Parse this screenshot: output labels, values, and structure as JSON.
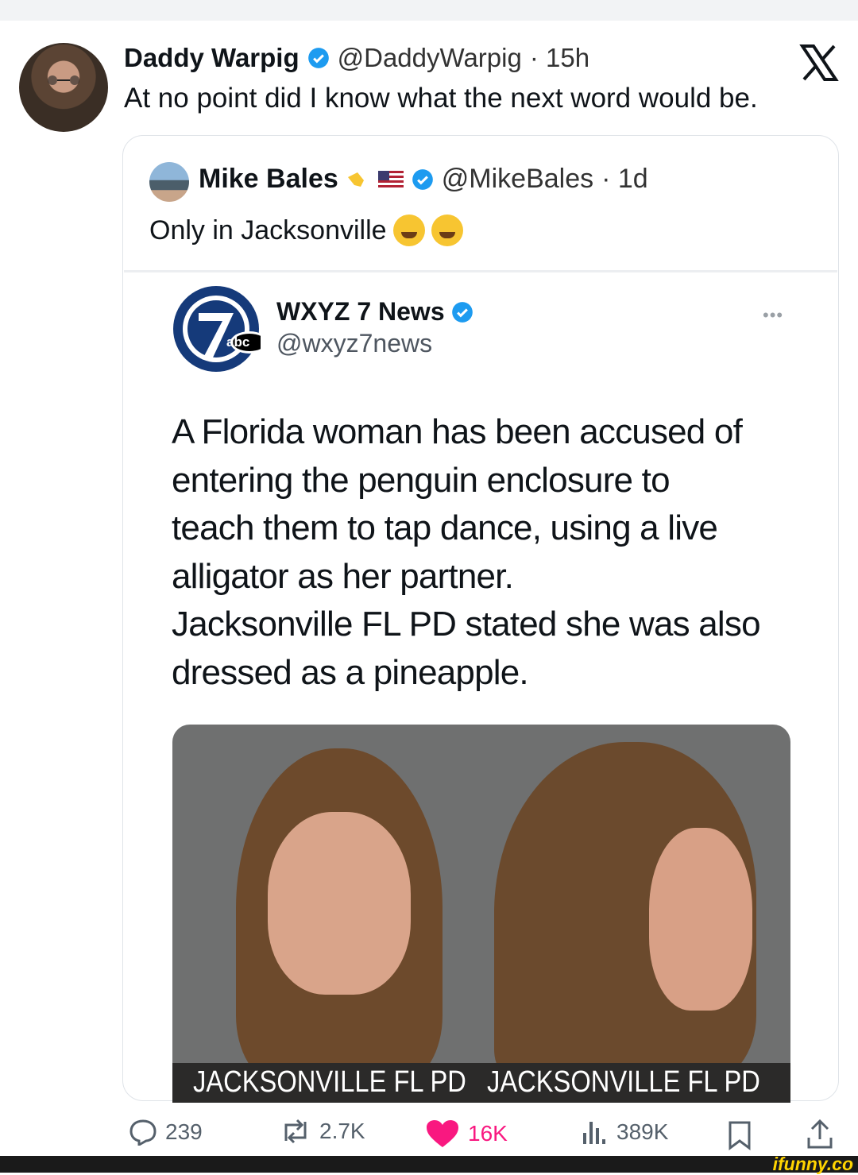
{
  "tweet": {
    "author_name": "Daddy Warpig",
    "author_handle": "@DaddyWarpig",
    "time": "· 15h",
    "text": "At no point did I know what the next word would be."
  },
  "quote": {
    "author_name": "Mike Bales",
    "author_handle": "@MikeBales",
    "time": "· 1d",
    "text": "Only in Jacksonville"
  },
  "embedded": {
    "name": "WXYZ 7 News",
    "handle": "@wxyz7news",
    "logo_text": "abc",
    "more": "•••",
    "lines": [
      "A Florida woman has been accused of",
      "entering the penguin enclosure to",
      "teach them to tap dance, using a live",
      "alligator as her partner.",
      "Jacksonville FL PD stated she was also",
      "dressed as a pineapple."
    ],
    "photo_caption_left": "JACKSONVILLE FL PD",
    "photo_caption_right": "JACKSONVILLE FL PD"
  },
  "actions": {
    "replies": "239",
    "reposts": "2.7K",
    "likes": "16K",
    "views": "389K"
  },
  "watermark": "ifunny.co",
  "colors": {
    "verified": "#1d9bf0",
    "like": "#f91880",
    "text": "#0f1419"
  }
}
